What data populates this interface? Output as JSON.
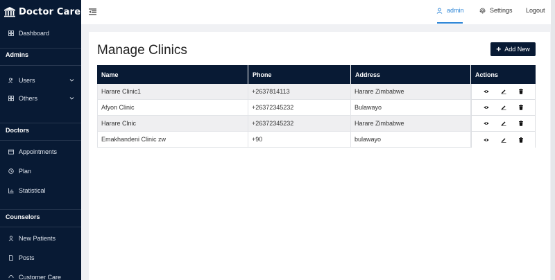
{
  "brand": {
    "name": "Doctor Care"
  },
  "sidebar": {
    "dashboard": "Dashboard",
    "admins_title": "Admins",
    "users": "Users",
    "others": "Others",
    "doctors_title": "Doctors",
    "appointments": "Appointments",
    "plan": "Plan",
    "statistical": "Statistical",
    "counselors_title": "Counselors",
    "new_patients": "New Patients",
    "posts": "Posts",
    "customer_care": "Customer Care"
  },
  "topbar": {
    "admin": "admin",
    "settings": "Settings",
    "logout": "Logout"
  },
  "page": {
    "title": "Manage Clinics",
    "add_button": "Add New"
  },
  "table": {
    "headers": [
      "Name",
      "Phone",
      "Address",
      "Actions"
    ],
    "rows": [
      {
        "name": "Harare Clinic1",
        "phone": "+2637814113",
        "address": "Harare Zimbabwe"
      },
      {
        "name": "Afyon Clinic",
        "phone": "+26372345232",
        "address": "Bulawayo"
      },
      {
        "name": "Harare Clnic",
        "phone": "+26372345232",
        "address": "Harare Zimbabwe"
      },
      {
        "name": "Emakhandeni Clinic zw",
        "phone": "+90",
        "address": "bulawayo"
      }
    ]
  },
  "colors": {
    "sidebar_bg": "#081a34",
    "accent": "#2a84d6"
  }
}
